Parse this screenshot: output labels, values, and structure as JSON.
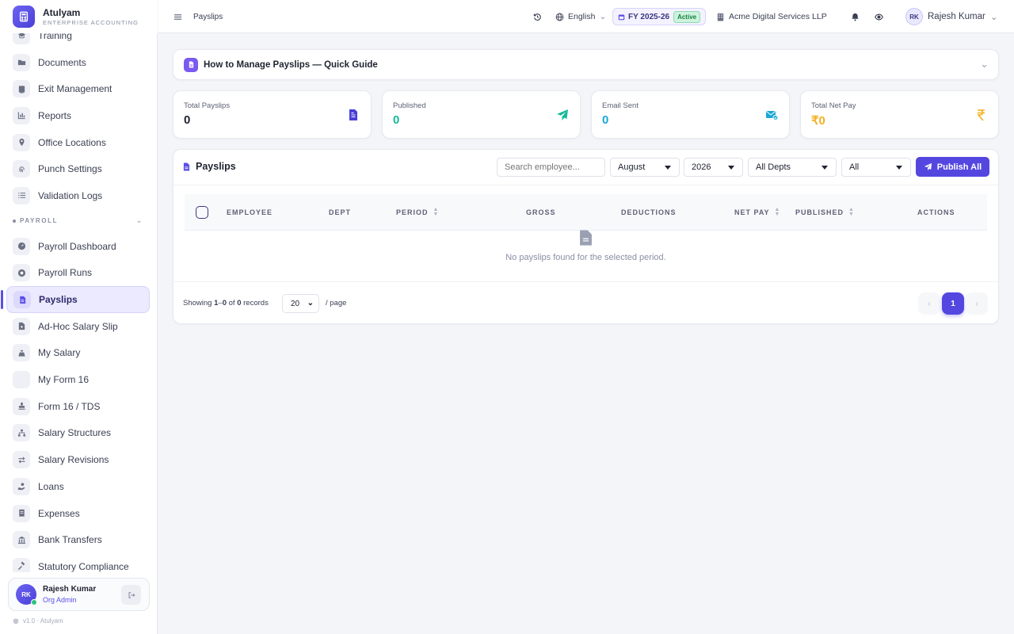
{
  "brand": {
    "name": "Atulyam",
    "subtitle": "ENTERPRISE ACCOUNTING",
    "logo_icon": "calculator-icon"
  },
  "sidebar": {
    "items_top": [
      {
        "label": "Training",
        "icon": "training-icon"
      },
      {
        "label": "Documents",
        "icon": "folder-icon"
      },
      {
        "label": "Exit Management",
        "icon": "exit-icon"
      },
      {
        "label": "Reports",
        "icon": "chart-icon"
      },
      {
        "label": "Office Locations",
        "icon": "pin-icon"
      },
      {
        "label": "Punch Settings",
        "icon": "fingerprint-icon"
      },
      {
        "label": "Validation Logs",
        "icon": "list-icon"
      }
    ],
    "section_label": "PAYROLL",
    "items_payroll": [
      {
        "label": "Payroll Dashboard",
        "icon": "gauge-icon"
      },
      {
        "label": "Payroll Runs",
        "icon": "play-icon"
      },
      {
        "label": "Payslips",
        "icon": "payslip-icon",
        "active": true
      },
      {
        "label": "Ad-Hoc Salary Slip",
        "icon": "file-plus-icon"
      },
      {
        "label": "My Salary",
        "icon": "money-bag-icon"
      },
      {
        "label": "My Form 16",
        "icon": "blank-icon"
      },
      {
        "label": "Form 16 / TDS",
        "icon": "stamp-icon"
      },
      {
        "label": "Salary Structures",
        "icon": "sitemap-icon"
      },
      {
        "label": "Salary Revisions",
        "icon": "swap-icon"
      },
      {
        "label": "Loans",
        "icon": "hand-coin-icon"
      },
      {
        "label": "Expenses",
        "icon": "receipt-icon"
      },
      {
        "label": "Bank Transfers",
        "icon": "bank-icon"
      },
      {
        "label": "Statutory Compliance",
        "icon": "gavel-icon"
      }
    ],
    "user": {
      "initials": "RK",
      "name": "Rajesh Kumar",
      "role": "Org Admin"
    },
    "version": "v1.0 · Atulyam"
  },
  "topbar": {
    "breadcrumb": "Payslips",
    "language": "English",
    "fy_label": "FY 2025-26",
    "fy_status": "Active",
    "company": "Acme Digital Services LLP",
    "user_initials": "RK",
    "user_name": "Rajesh Kumar"
  },
  "guide": {
    "title": "How to Manage Payslips — Quick Guide"
  },
  "stats": [
    {
      "label": "Total Payslips",
      "value": "0",
      "color": "#1f2330",
      "icon": "document-icon",
      "icon_color": "#4a3fd6"
    },
    {
      "label": "Published",
      "value": "0",
      "color": "#16b99a",
      "icon": "paper-plane-icon",
      "icon_color": "#16b99a"
    },
    {
      "label": "Email Sent",
      "value": "0",
      "color": "#1aa9d6",
      "icon": "email-check-icon",
      "icon_color": "#1aa9d6"
    },
    {
      "label": "Total Net Pay",
      "value": "₹0",
      "color": "#f2b01e",
      "icon": "rupee-icon",
      "icon_color": "#f2b01e"
    }
  ],
  "payslips": {
    "title": "Payslips",
    "search_placeholder": "Search employee...",
    "month": "August",
    "year": "2026",
    "dept": "All Depts",
    "status": "All",
    "publish_all": "Publish All",
    "columns": [
      "EMPLOYEE",
      "DEPT",
      "PERIOD",
      "GROSS",
      "DEDUCTIONS",
      "NET PAY",
      "PUBLISHED",
      "ACTIONS"
    ],
    "empty_text": "No payslips found for the selected period.",
    "showing_prefix": "Showing",
    "range_start": "1",
    "range_sep": "–",
    "range_end": "0",
    "of": "of",
    "total": "0",
    "records": "records",
    "page_size": "20",
    "per_page": "/ page",
    "current_page": "1"
  },
  "colors": {
    "accent": "#5b4fe6",
    "sidebar_bg": "#ffffff",
    "page_bg": "#f4f5f9"
  }
}
